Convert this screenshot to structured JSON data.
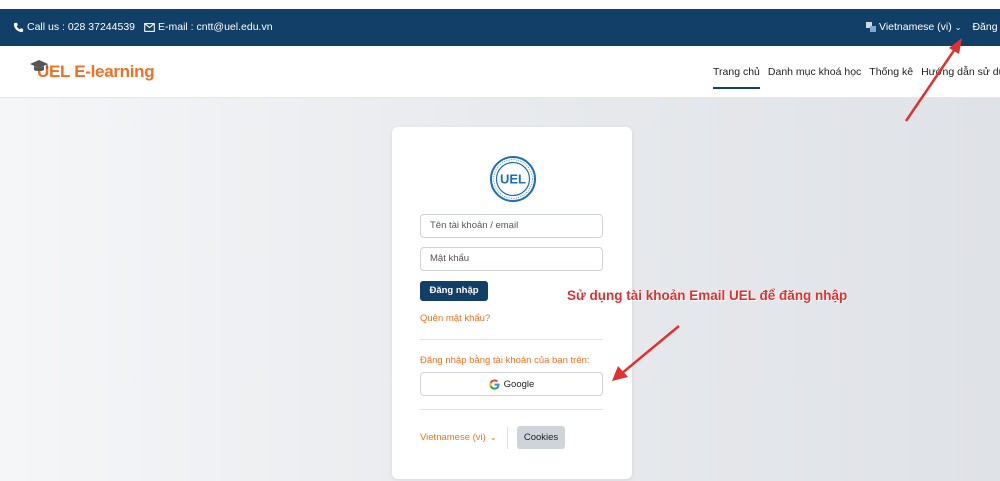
{
  "topbar": {
    "phone": "Call us : 028 37244539",
    "email": "E-mail : cntt@uel.edu.vn",
    "language": "Vietnamese (vi)",
    "login_link": "Đăng nhập"
  },
  "navbar": {
    "logo_text": "UEL E-learning",
    "links": [
      "Trang chủ",
      "Danh mục khoá học",
      "Thống kê",
      "Hướng dẫn sử dụng"
    ]
  },
  "login": {
    "emblem_text": "UEL",
    "username_placeholder": "Tên tài khoản / email",
    "password_placeholder": "Mật khẩu",
    "login_button": "Đăng nhập",
    "forgot_password": "Quên mật khẩu?",
    "alt_login_title": "Đăng nhập bằng tài khoản của bạn trên:",
    "google_button": "Google",
    "footer_language": "Vietnamese (vi)",
    "cookies_button": "Cookies"
  },
  "annotation": {
    "text": "Sử dụng tài khoản Email UEL để đăng nhập"
  },
  "colors": {
    "brand_navy": "#113f67",
    "accent_orange": "#f36f21",
    "annotation_red": "#e03131"
  },
  "icons": {
    "phone": "phone-icon",
    "email": "envelope-icon",
    "language": "language-icon",
    "google": "google-icon",
    "chevron": "chevron-down-icon"
  }
}
